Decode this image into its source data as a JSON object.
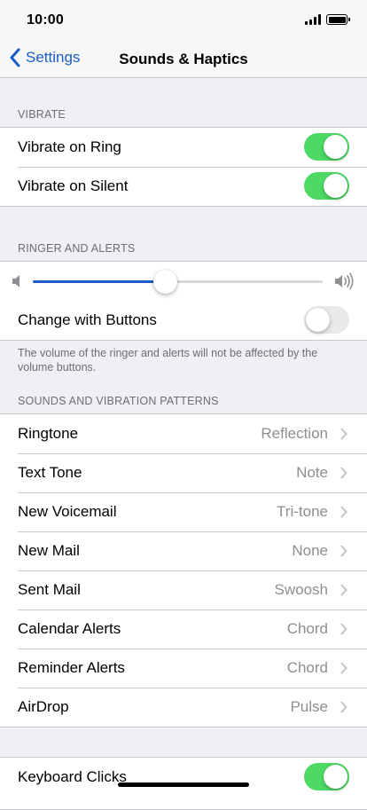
{
  "status_bar": {
    "time": "10:00"
  },
  "nav": {
    "back_label": "Settings",
    "title": "Sounds & Haptics"
  },
  "vibrate": {
    "header": "VIBRATE",
    "rows": [
      {
        "label": "Vibrate on Ring",
        "on": true
      },
      {
        "label": "Vibrate on Silent",
        "on": true
      }
    ]
  },
  "ringer": {
    "header": "RINGER AND ALERTS",
    "volume_level": 0.46,
    "change_with_buttons": {
      "label": "Change with Buttons",
      "on": false
    },
    "footer": "The volume of the ringer and alerts will not be affected by the volume buttons."
  },
  "patterns": {
    "header": "SOUNDS AND VIBRATION PATTERNS",
    "rows": [
      {
        "label": "Ringtone",
        "value": "Reflection"
      },
      {
        "label": "Text Tone",
        "value": "Note"
      },
      {
        "label": "New Voicemail",
        "value": "Tri-tone"
      },
      {
        "label": "New Mail",
        "value": "None"
      },
      {
        "label": "Sent Mail",
        "value": "Swoosh"
      },
      {
        "label": "Calendar Alerts",
        "value": "Chord"
      },
      {
        "label": "Reminder Alerts",
        "value": "Chord"
      },
      {
        "label": "AirDrop",
        "value": "Pulse"
      }
    ]
  },
  "keyboard": {
    "label": "Keyboard Clicks",
    "on": true
  },
  "colors": {
    "accent": "#1a5dc6",
    "toggle_on": "#4cd964",
    "toggle_off": "#e9e9eb"
  },
  "icons": [
    "chevron-left-icon",
    "speaker-low-icon",
    "speaker-high-icon",
    "chevron-right-icon",
    "signal-icon",
    "battery-icon"
  ]
}
